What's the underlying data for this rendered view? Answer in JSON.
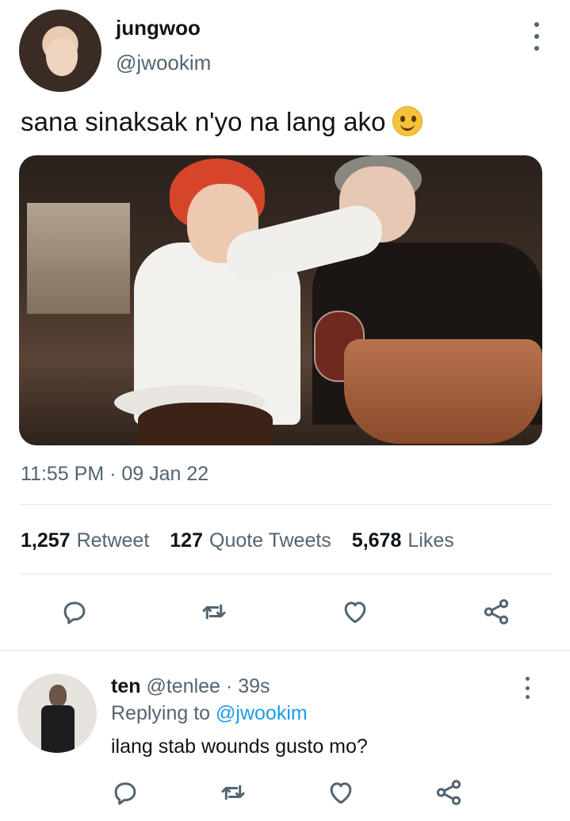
{
  "tweet": {
    "author": {
      "name": "jungwoo",
      "handle": "@jwookim"
    },
    "text": "sana sinaksak n'yo na lang ako",
    "emoji": "slightly-smiling-face",
    "timestamp": "11:55 PM · 09 Jan 22",
    "stats": {
      "retweets": {
        "count": "1,257",
        "label": "Retweet"
      },
      "quotes": {
        "count": "127",
        "label": "Quote Tweets"
      },
      "likes": {
        "count": "5,678",
        "label": "Likes"
      }
    },
    "actions": [
      "reply-icon",
      "retweet-icon",
      "like-icon",
      "share-icon"
    ]
  },
  "reply": {
    "author": {
      "name": "ten",
      "handle": "@tenlee",
      "time": "39s"
    },
    "replying_prefix": "Replying to",
    "replying_to": "@jwookim",
    "text": "ilang stab wounds gusto mo?",
    "actions": [
      "reply-icon",
      "retweet-icon",
      "like-icon",
      "share-icon"
    ]
  },
  "colors": {
    "text_primary": "#0f1419",
    "text_secondary": "#536471",
    "link": "#1d9bf0",
    "divider": "#e4e8eb"
  }
}
